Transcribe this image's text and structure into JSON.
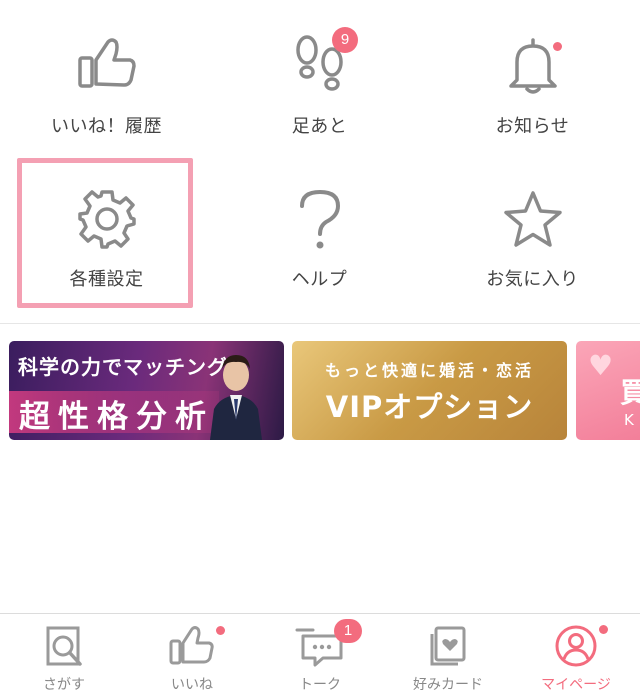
{
  "menu": {
    "likes_history": "いいね！履歴",
    "footprints": "足あと",
    "footprints_badge": "9",
    "notifications": "お知らせ",
    "settings": "各種設定",
    "help": "ヘルプ",
    "favorites": "お気に入り"
  },
  "banners": {
    "personality": {
      "line1": "科学の力でマッチング",
      "line2": "超性格分析"
    },
    "vip": {
      "line1": "もっと快適に婚活・恋活",
      "line2": "VIPオプション"
    },
    "partial": {
      "line1": "買",
      "line2": "K"
    }
  },
  "tabbar": {
    "search": "さがす",
    "likes": "いいね",
    "talk": "トーク",
    "talk_badge": "1",
    "cards": "好みカード",
    "mypage": "マイページ"
  },
  "colors": {
    "accent": "#f36c7e",
    "highlight_border": "#f4a0b3",
    "icon_gray": "#8a8a8a"
  }
}
